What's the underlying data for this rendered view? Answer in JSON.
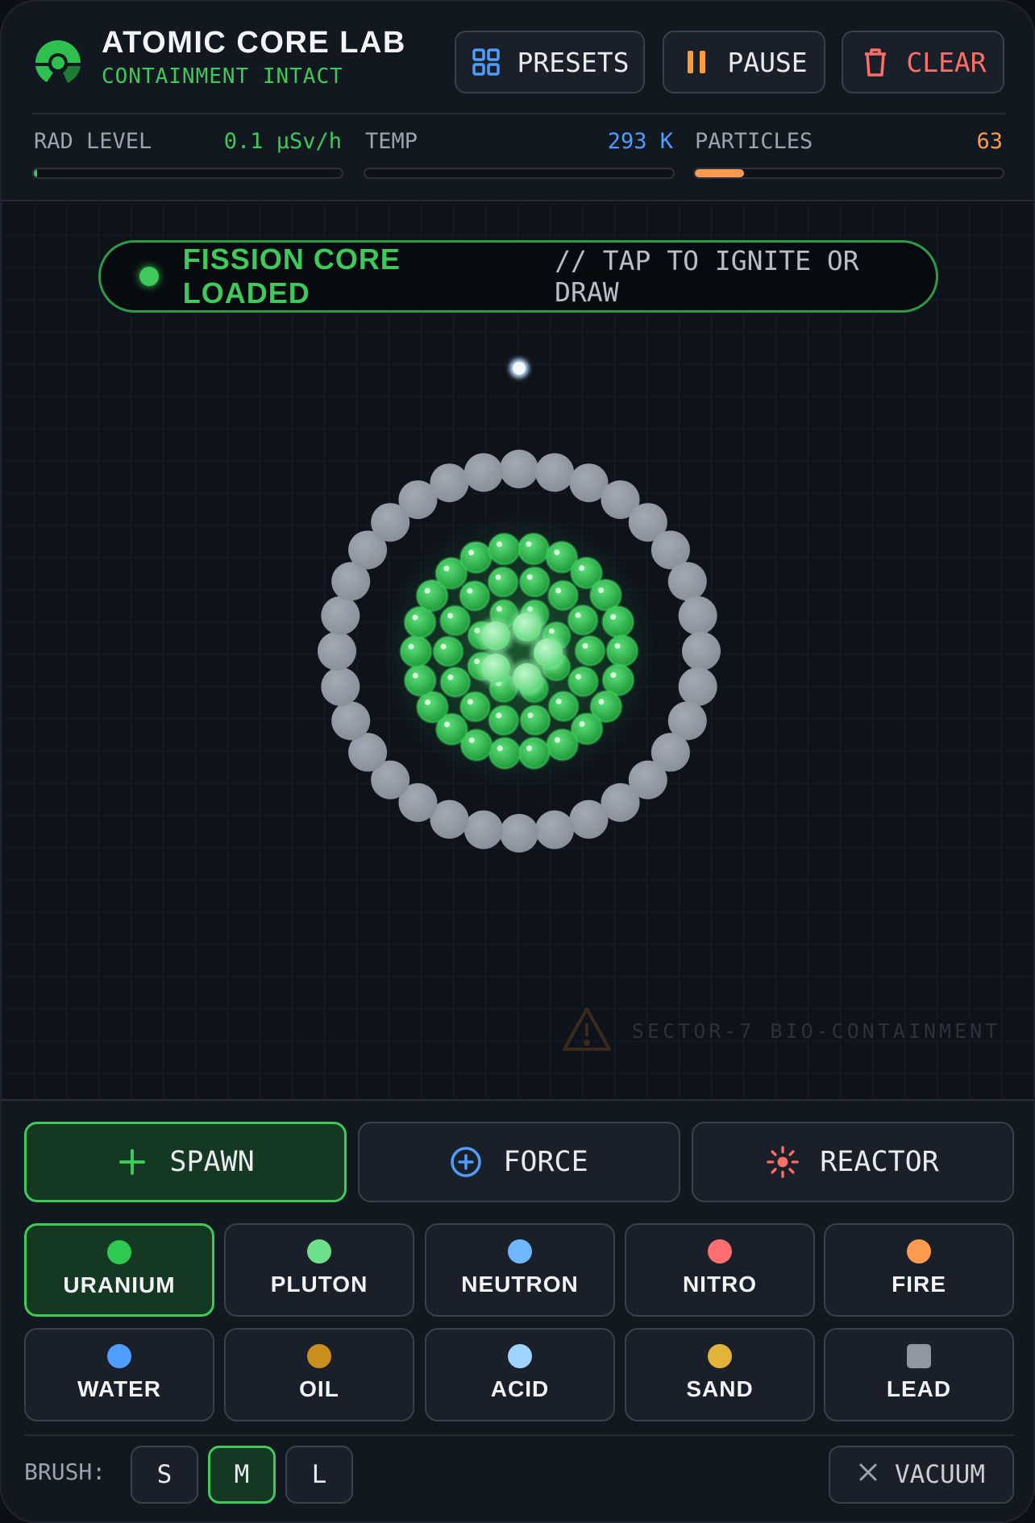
{
  "header": {
    "title": "ATOMIC CORE LAB",
    "subtitle": "CONTAINMENT INTACT",
    "buttons": {
      "presets": "PRESETS",
      "pause": "PAUSE",
      "clear": "CLEAR"
    }
  },
  "meters": {
    "rad": {
      "label": "RAD LEVEL",
      "value": "0.1 μSv/h",
      "fraction": 0.01,
      "color": "#3ec95a"
    },
    "temp": {
      "label": "TEMP",
      "value": "293 K",
      "fraction": 0.0,
      "color": "#4f9dff"
    },
    "particles": {
      "label": "PARTICLES",
      "value": "63",
      "fraction": 0.16,
      "color": "#ff9b4f"
    }
  },
  "sim": {
    "banner_status": "FISSION CORE LOADED",
    "banner_hint": "// TAP TO IGNITE OR DRAW",
    "sector_label": "SECTOR-7 BIO-CONTAINMENT"
  },
  "modes": [
    {
      "label": "SPAWN",
      "icon": "plus-icon",
      "active": true
    },
    {
      "label": "FORCE",
      "icon": "force-icon",
      "active": false
    },
    {
      "label": "REACTOR",
      "icon": "reactor-icon",
      "active": false
    }
  ],
  "elements": [
    {
      "label": "URANIUM",
      "color": "#2fc94f",
      "active": true
    },
    {
      "label": "PLUTON",
      "color": "#6fe08a",
      "active": false
    },
    {
      "label": "NEUTRON",
      "color": "#6fb7ff",
      "active": false
    },
    {
      "label": "NITRO",
      "color": "#ff6f6f",
      "active": false
    },
    {
      "label": "FIRE",
      "color": "#ff9b4f",
      "active": false
    },
    {
      "label": "WATER",
      "color": "#4f9dff",
      "active": false
    },
    {
      "label": "OIL",
      "color": "#c98f1e",
      "active": false
    },
    {
      "label": "ACID",
      "color": "#9fd4ff",
      "active": false
    },
    {
      "label": "SAND",
      "color": "#e2b33a",
      "active": false
    },
    {
      "label": "LEAD",
      "color": "#8e96a2",
      "active": false
    }
  ],
  "brush": {
    "label": "BRUSH:",
    "sizes": [
      "S",
      "M",
      "L"
    ],
    "selected": "M"
  },
  "vacuum": "VACUUM"
}
